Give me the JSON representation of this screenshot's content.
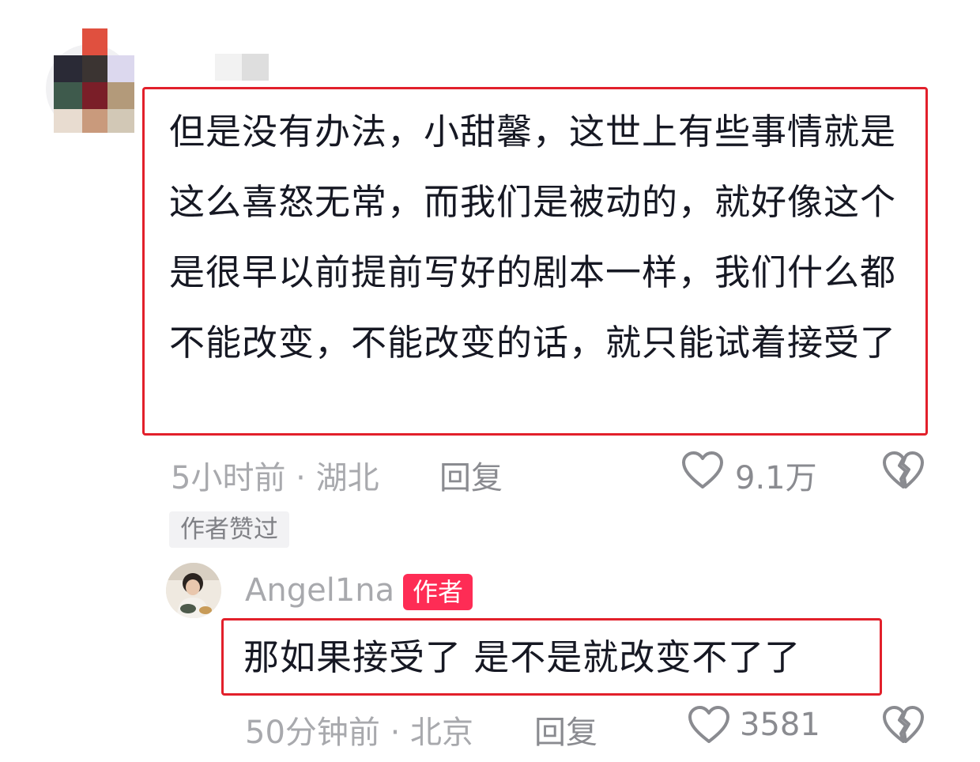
{
  "comment": {
    "text": "但是没有办法，小甜馨，这世上有些事情就是这么喜怒无常，而我们是被动的，就好像这个是很早以前提前写好的剧本一样，我们什么都不能改变，不能改变的话，就只能试着接受了",
    "time_location": "5小时前 · 湖北",
    "reply_label": "回复",
    "like_count": "9.1万",
    "author_liked_tag": "作者赞过"
  },
  "reply": {
    "username": "Angel1na",
    "badge": "作者",
    "text": "那如果接受了 是不是就改变不了了",
    "time_location": "50分钟前 · 北京",
    "reply_label": "回复",
    "like_count": "3581"
  },
  "icons": {
    "like": "heart-outline-icon",
    "dislike": "broken-heart-icon"
  },
  "colors": {
    "highlight_border": "#e2202b",
    "author_badge": "#fe2c55",
    "meta_text": "#a8a9ad"
  }
}
